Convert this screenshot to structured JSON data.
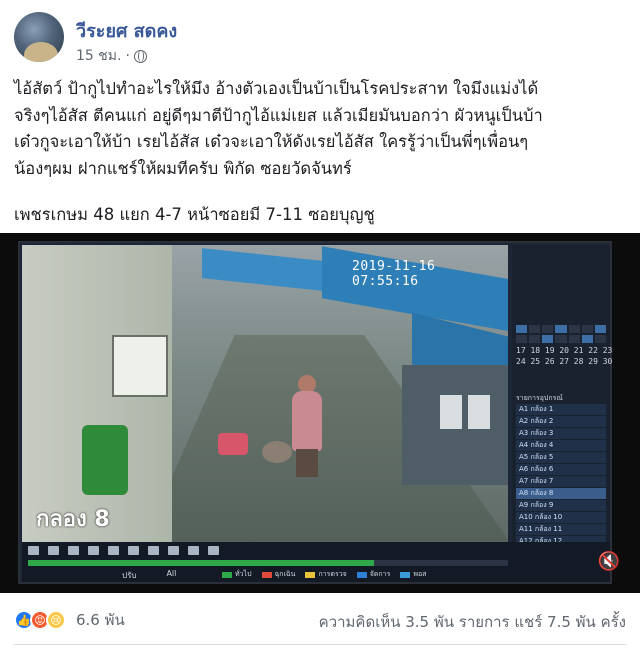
{
  "post": {
    "author": "วีระยศ สดคง",
    "time": "15 ชม.",
    "privacy_icon": "globe-icon",
    "text_lines": [
      "ไอ้สัตว์ ป้ากูไปทำอะไรให้มึง อ้างตัวเองเป็นบ้าเป็นโรคประสาท ใจมึงแม่งได้",
      "จริงๆไอ้สัส ตีคนแก่ อยู่ดีๆมาตีป้ากูไอ้แม่เยส แล้วเมียมันบอกว่า ผัวหนูเป็นบ้า",
      "เด๋วกูจะเอาให้บ้า เรยไอ้สัส เด๋วจะเอาให้ดังเรยไอ้สัส ใครรู้ว่าเป็นพี่ๆเพื่อนๆ",
      "น้องๆผม ฝากแชร์ให้ผมทีครับ พิกัด ซอยวัดจันทร์"
    ],
    "location": "เพชรเกษม 48 แยก 4-7 หน้าซอยมี 7-11 ซอยบุญชู"
  },
  "video": {
    "timestamp": "2019-11-16 07:55:16",
    "camera_label": "กลอง 8",
    "calendar_numbers": [
      "17 18 19 20 21 22 23",
      "24 25 26 27 28 29 30"
    ],
    "camera_list_title": "รายการอุปกรณ์",
    "camera_list": [
      "A1 กล้อง 1",
      "A2 กล้อง 2",
      "A3 กล้อง 3",
      "A4 กล้อง 4",
      "A5 กล้อง 5",
      "A6 กล้อง 6",
      "A7 กล้อง 7",
      "A8 กล้อง 8",
      "A9 กล้อง 9",
      "A10 กล้อง 10",
      "A11 กล้อง 11",
      "A12 กล้อง 12",
      "A13 กล้อง 13"
    ],
    "selected_camera_index": 7,
    "timeline_progress": 0.72,
    "control_labels": [
      "ปรับ",
      "All"
    ],
    "legend": [
      {
        "label": "ทั่วไป",
        "color": "#2fa84a"
      },
      {
        "label": "ฉุกเฉิน",
        "color": "#e04a3c"
      },
      {
        "label": "การตรวจ",
        "color": "#e8c23a"
      },
      {
        "label": "จัดการ",
        "color": "#2f7fd6"
      },
      {
        "label": "พอส",
        "color": "#3a9bd6"
      }
    ],
    "mute_icon": "speaker-muted-icon"
  },
  "footer": {
    "reaction_icons": [
      "like-icon",
      "angry-icon",
      "sad-icon"
    ],
    "reaction_count": "6.6 พัน",
    "stats": "ความคิดเห็น 3.5 พัน รายการ  แชร์ 7.5 พัน ครั้ง"
  },
  "colors": {
    "author_link": "#385898",
    "meta_text": "#606770",
    "like_blue": "#2078f4",
    "angry_orange": "#f25b2e",
    "sad_yellow": "#f7c947"
  }
}
